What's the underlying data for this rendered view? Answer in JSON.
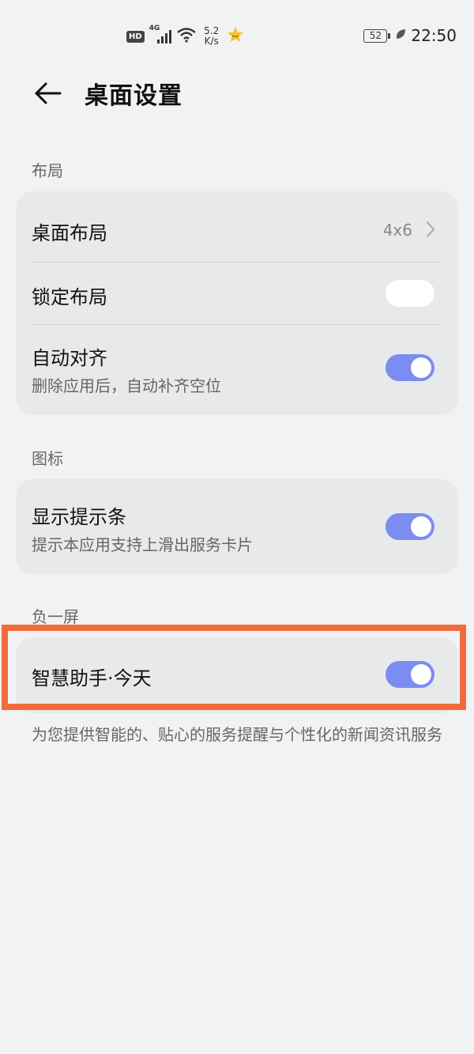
{
  "status_bar": {
    "hd_badge": "HD",
    "network_type": "4G",
    "speed_value": "5.2",
    "speed_unit": "K/s",
    "battery_level": "52",
    "time": "22:50",
    "icons": [
      "hd-icon",
      "signal-icon",
      "wifi-icon",
      "star-icon",
      "battery-icon",
      "leaf-icon"
    ]
  },
  "header": {
    "back_icon": "arrow-left-icon",
    "title": "桌面设置"
  },
  "sections": {
    "layout": {
      "label": "布局",
      "desktop_layout": {
        "title": "桌面布局",
        "value": "4x6"
      },
      "lock_layout": {
        "title": "锁定布局",
        "enabled": false
      },
      "auto_align": {
        "title": "自动对齐",
        "subtitle": "删除应用后，自动补齐空位",
        "enabled": true
      }
    },
    "icons": {
      "label": "图标",
      "show_hint_bar": {
        "title": "显示提示条",
        "subtitle": "提示本应用支持上滑出服务卡片",
        "enabled": true
      }
    },
    "minus_one_screen": {
      "label": "负一屏",
      "smart_assistant": {
        "title": "智慧助手·今天",
        "enabled": true
      },
      "description": "为您提供智能的、贴心的服务提醒与个性化的新闻资讯服务"
    }
  },
  "colors": {
    "background": "#f1f2f4",
    "card": "#e8e9eb",
    "toggle_on": "#7b8df0",
    "highlight": "#f26b3a"
  }
}
